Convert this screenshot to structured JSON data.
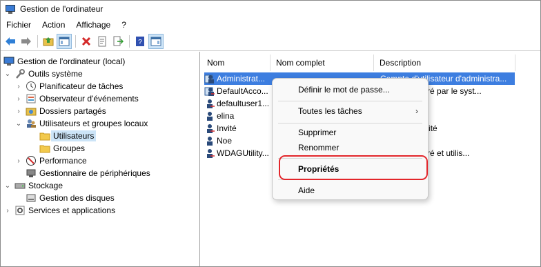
{
  "window": {
    "title": "Gestion de l'ordinateur"
  },
  "menu": [
    "Fichier",
    "Action",
    "Affichage",
    "?"
  ],
  "toolbar": {
    "buttons": [
      "back-icon",
      "forward-icon",
      "up-folder-icon",
      "show-tree-icon",
      "delete-icon",
      "properties-icon",
      "export-icon",
      "help-icon",
      "action-pane-icon"
    ]
  },
  "tree": [
    {
      "label": "Gestion de l'ordinateur (local)",
      "icon": "computer-management-icon",
      "expanded": true
    },
    {
      "label": "Outils système",
      "icon": "tools-icon",
      "expanded": true
    },
    {
      "label": "Planificateur de tâches",
      "icon": "clock-icon",
      "expanded": false
    },
    {
      "label": "Observateur d'événements",
      "icon": "event-viewer-icon",
      "expanded": false
    },
    {
      "label": "Dossiers partagés",
      "icon": "shared-folder-icon",
      "expanded": false
    },
    {
      "label": "Utilisateurs et groupes locaux",
      "icon": "users-groups-icon",
      "expanded": true
    },
    {
      "label": "Utilisateurs",
      "icon": "folder-icon",
      "selected": true
    },
    {
      "label": "Groupes",
      "icon": "folder-icon"
    },
    {
      "label": "Performance",
      "icon": "performance-icon",
      "expanded": false
    },
    {
      "label": "Gestionnaire de périphériques",
      "icon": "device-manager-icon"
    },
    {
      "label": "Stockage",
      "icon": "storage-icon",
      "expanded": true
    },
    {
      "label": "Gestion des disques",
      "icon": "disk-icon"
    },
    {
      "label": "Services et applications",
      "icon": "services-icon",
      "expanded": false
    }
  ],
  "columns": [
    "Nom",
    "Nom complet",
    "Description"
  ],
  "users": [
    {
      "name": "Administrat...",
      "description": "Compte d'utilisateur d'administra...",
      "selected": true
    },
    {
      "name": "DefaultAcco...",
      "description": "...ilisateur géré par le syst..."
    },
    {
      "name": "defaultuser1...",
      "description": ""
    },
    {
      "name": "elina",
      "description": ""
    },
    {
      "name": "Invité",
      "description": "...ilisateur invité"
    },
    {
      "name": "Noe",
      "description": ""
    },
    {
      "name": "WDAGUtility...",
      "description": "...ilisateur géré et utilis..."
    }
  ],
  "context_menu": {
    "set_password": "Définir le mot de passe...",
    "all_tasks": "Toutes les tâches",
    "delete": "Supprimer",
    "rename": "Renommer",
    "properties": "Propriétés",
    "help": "Aide"
  },
  "colors": {
    "selection": "#3d7ee0",
    "highlight_ring": "#e3262b",
    "tree_selection": "#cce4f7"
  }
}
